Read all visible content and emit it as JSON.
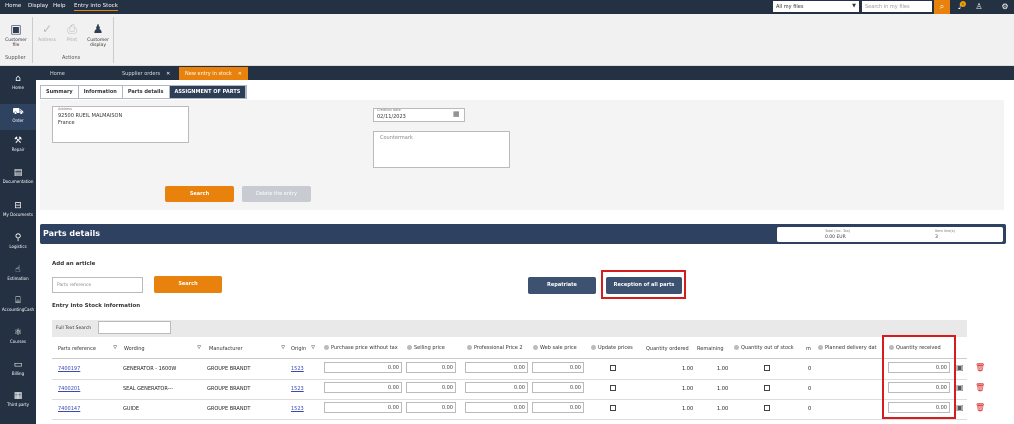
{
  "topbar": {
    "menu": [
      "Home",
      "Display",
      "Help",
      "Entry into Stock"
    ],
    "files_select": "All my files",
    "search_placeholder": "Search in my files",
    "notification_count": "1"
  },
  "ribbon": {
    "customer_file": "Customer file",
    "supplier_group": "Supplier",
    "address": "Address",
    "print": "Print",
    "customer_display": "Customer display",
    "actions_group": "Actions"
  },
  "sidenav": [
    "Home",
    "Order",
    "Repair",
    "Documentation",
    "My Documents",
    "Logistics",
    "Estimation",
    "AccountingCash",
    "Courses",
    "Billing",
    "Third party"
  ],
  "window_tabs": [
    {
      "label": "Home"
    },
    {
      "label": "Supplier orders"
    },
    {
      "label": "New entry in stock"
    }
  ],
  "subtabs": [
    "Summary",
    "Information",
    "Parts details",
    "ASSIGNMENT OF PARTS"
  ],
  "form": {
    "address_label": "Address",
    "address_line1": "92500 RUEIL MALMAISON",
    "address_line2": "France",
    "date_label": "Creation date",
    "date_value": "02/11/2023",
    "countermark_placeholder": "Countermark",
    "search_button": "Search",
    "delete_button": "Delete the entry"
  },
  "parts": {
    "title": "Parts details",
    "total_label": "Total (inc. Tax)",
    "total_value": "0.00 EUR",
    "items_label": "Item line(s)",
    "items_value": "3",
    "add_article": "Add an article",
    "parts_reference_placeholder": "Parts reference",
    "search_button": "Search",
    "repatriate_button": "Repatriate",
    "reception_button": "Reception of all parts",
    "entry_info": "Entry into Stock information",
    "full_text_search": "Full Text Search"
  },
  "table": {
    "headers": {
      "parts_reference": "Parts reference",
      "wording": "Wording",
      "manufacturer": "Manufacturer",
      "origin": "Origin",
      "purchase_price": "Purchase price without tax",
      "selling_price": "Selling price",
      "professional_price": "Professional Price 2",
      "web_sale_price": "Web sale price",
      "update_prices": "Update prices",
      "quantity_ordered": "Quantity ordered",
      "remaining": "Remaining",
      "quantity_out_of_stock": "Quantity out of stock",
      "m": "m",
      "planned_delivery": "Planned delivery dat",
      "quantity_received": "Quantity received"
    },
    "rows": [
      {
        "ref": "7400197",
        "wording": "GENERATOR - 1600W",
        "manufacturer": "GROUPE BRANDT",
        "origin": "1523",
        "purchase": "0.00",
        "selling": "0.00",
        "professional": "0.00",
        "web": "0.00",
        "qty_ordered": "1.00",
        "remaining": "1.00",
        "m": "0",
        "received": "0.00"
      },
      {
        "ref": "7400201",
        "wording": "SEAL GENERATOR---",
        "manufacturer": "GROUPE BRANDT",
        "origin": "1523",
        "purchase": "0.00",
        "selling": "0.00",
        "professional": "0.00",
        "web": "0.00",
        "qty_ordered": "1.00",
        "remaining": "1.00",
        "m": "0",
        "received": "0.00"
      },
      {
        "ref": "7400147",
        "wording": "GUIDE",
        "manufacturer": "GROUPE BRANDT",
        "origin": "1523",
        "purchase": "0.00",
        "selling": "0.00",
        "professional": "0.00",
        "web": "0.00",
        "qty_ordered": "1.00",
        "remaining": "1.00",
        "m": "0",
        "received": "0.00"
      }
    ]
  },
  "colors": {
    "accent": "#e8820c",
    "navy": "#243142",
    "highlight": "#d61d1d"
  }
}
